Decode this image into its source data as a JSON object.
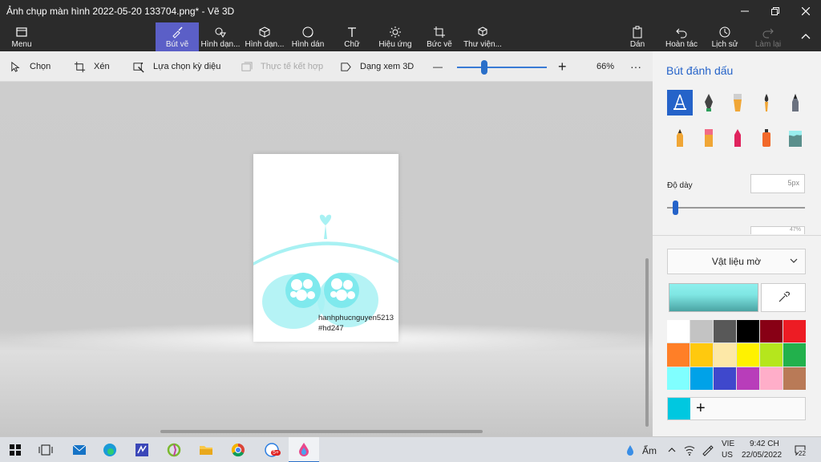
{
  "window": {
    "title": "Ảnh chụp màn hình 2022-05-20 133704.png* - Vẽ 3D",
    "minimize_icon": "minimize-icon",
    "maximize_icon": "restore-icon",
    "close_icon": "close-icon"
  },
  "ribbon": {
    "menu": "Menu",
    "tabs": [
      {
        "label": "Bút vẽ",
        "icon": "brush-icon",
        "active": true
      },
      {
        "label": "Hình dạn...",
        "icon": "shapes-2d-icon"
      },
      {
        "label": "Hình dạn...",
        "icon": "shapes-3d-icon"
      },
      {
        "label": "Hình dán",
        "icon": "sticker-icon"
      },
      {
        "label": "Chữ",
        "icon": "text-icon"
      },
      {
        "label": "Hiệu ứng",
        "icon": "effects-icon"
      },
      {
        "label": "Bức vẽ",
        "icon": "canvas-icon"
      },
      {
        "label": "Thư viện...",
        "icon": "library-icon"
      }
    ],
    "paste": "Dán",
    "undo": "Hoàn tác",
    "history": "Lịch sử",
    "redo": "Làm lại"
  },
  "toolbar": {
    "select": "Chọn",
    "crop": "Xén",
    "magic_select": "Lựa chọn kỳ diệu",
    "mixed_reality": "Thực tế kết hợp",
    "view_3d": "Dạng xem 3D",
    "zoom_minus": "—",
    "zoom_plus": "+",
    "zoom_level": "66%",
    "zoom_fraction": 0.3,
    "more": "···"
  },
  "canvas": {
    "watermark_line1": "hanhphucnguyen5213",
    "watermark_line2": "#hd247",
    "drawing_color": "#a8f1f3"
  },
  "panel": {
    "title": "Bút đánh dấu",
    "brushes": [
      "marker-icon",
      "calligraphy-pen-icon",
      "oil-brush-icon",
      "watercolor-icon",
      "pixel-pen-icon",
      "pencil-icon",
      "eraser-icon",
      "crayon-icon",
      "spray-can-icon",
      "fill-bucket-icon"
    ],
    "thickness_label": "Độ dày",
    "thickness_value": "5px",
    "thickness_fraction": 0.04,
    "opacity_peek": "47%",
    "material": "Vật liệu mờ",
    "current_color": "#80e8e6",
    "eyedropper_icon": "eyedropper-icon",
    "swatches": [
      "#ffffff",
      "#c3c3c3",
      "#585858",
      "#000000",
      "#880015",
      "#ed1c24",
      "#ff7f27",
      "#ffc90e",
      "#fde8a7",
      "#fff200",
      "#b5e61d",
      "#22b14c",
      "#80ffff",
      "#00a2e8",
      "#3f48cc",
      "#b83dba",
      "#ffaec9",
      "#b97a57"
    ],
    "custom_color": "#00c8e0",
    "add_color": "+"
  },
  "taskbar": {
    "apps": [
      "windows-start-icon",
      "task-view-icon",
      "mail-icon",
      "edge-icon",
      "app-icon",
      "lightshot-icon",
      "file-explorer-icon",
      "chrome-icon",
      "messenger-icon",
      "paint-3d-icon"
    ],
    "messenger_badge": "5+",
    "weather": "Ẩm",
    "lang_top": "VIE",
    "lang_bottom": "US",
    "time": "9:42 CH",
    "date": "22/05/2022",
    "notif_count": "22"
  }
}
